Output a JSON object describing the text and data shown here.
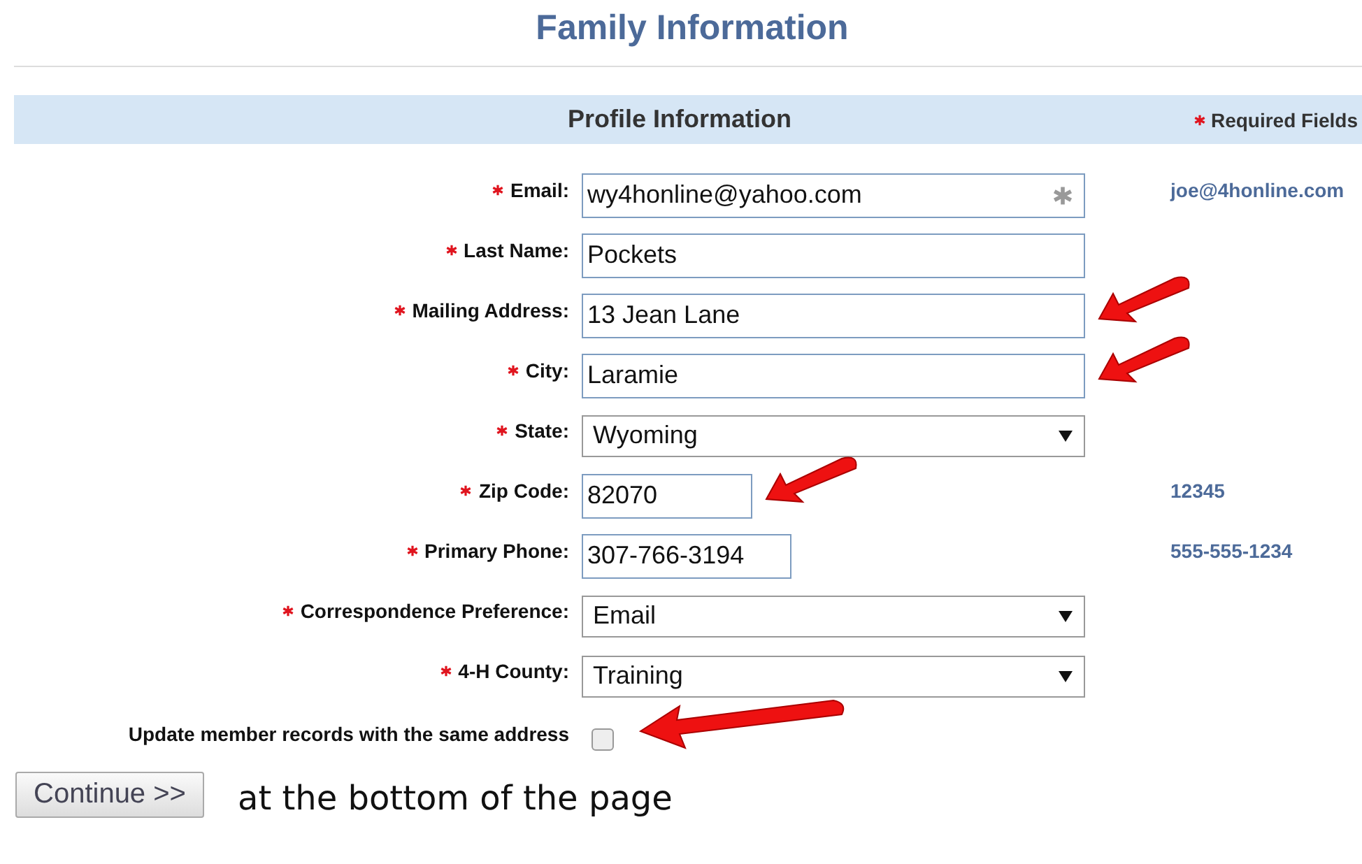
{
  "title": "Family Information",
  "section": {
    "title": "Profile Information",
    "required_note": "Required Fields"
  },
  "fields": [
    {
      "label": "Email:",
      "required": true,
      "kind": "text",
      "value": "wy4honline@yahoo.com",
      "required_mark": true,
      "hint": "joe@4honline.com"
    },
    {
      "label": "Last Name:",
      "required": true,
      "kind": "text",
      "value": "Pockets"
    },
    {
      "label": "Mailing Address:",
      "required": true,
      "kind": "text",
      "value": "13 Jean Lane",
      "arrow": true
    },
    {
      "label": "City:",
      "required": true,
      "kind": "text",
      "value": "Laramie",
      "arrow": true
    },
    {
      "label": "State:",
      "required": true,
      "kind": "select",
      "value": "Wyoming"
    },
    {
      "label": "Zip Code:",
      "required": true,
      "kind": "short",
      "value": "82070",
      "hint": "12345",
      "arrow": true
    },
    {
      "label": "Primary Phone:",
      "required": true,
      "kind": "medium",
      "value": "307-766-3194",
      "hint": "555-555-1234"
    },
    {
      "label": "Correspondence Preference:",
      "required": true,
      "kind": "select",
      "value": "Email"
    },
    {
      "label": "4-H County:",
      "required": true,
      "kind": "select",
      "value": "Training"
    }
  ],
  "update_records": {
    "label": "Update member records with the same address",
    "checked": false,
    "arrow": true
  },
  "continue_button": "Continue >>",
  "caption": "at the bottom of the page"
}
